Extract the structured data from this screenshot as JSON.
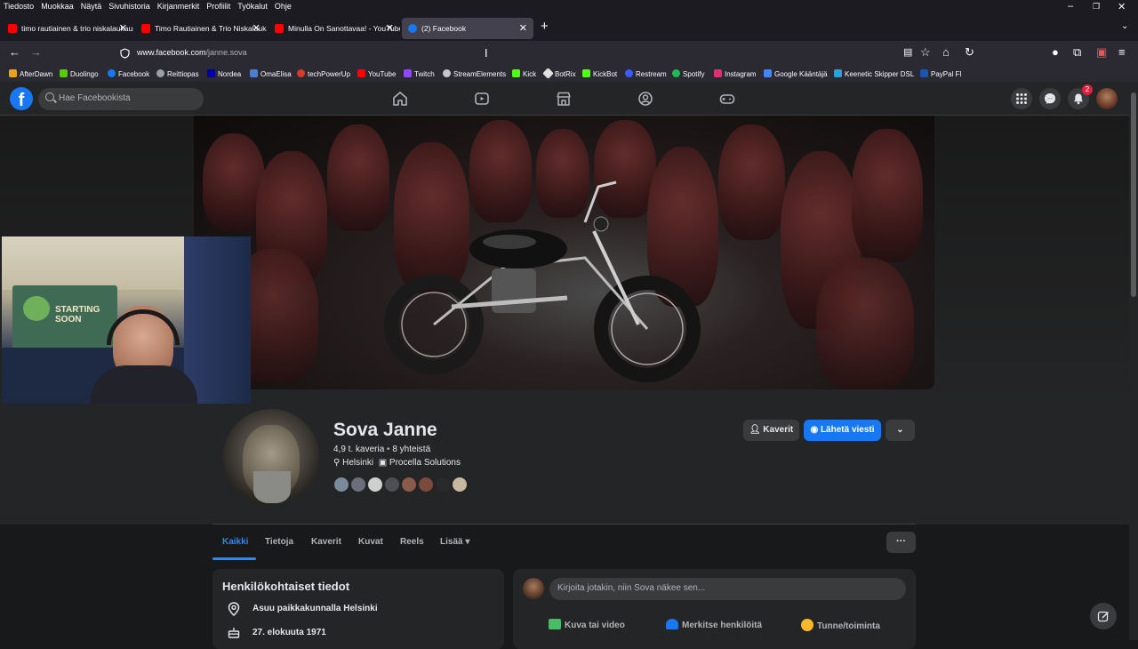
{
  "browser": {
    "menu": [
      "Tiedosto",
      "Muokkaa",
      "Näytä",
      "Sivuhistoria",
      "Kirjanmerkit",
      "Profiilit",
      "Työkalut",
      "Ohje"
    ],
    "tabs": [
      {
        "title": "timo rautiainen & trio niskalaukaus",
        "icon": "youtube-icon",
        "color": "#ff0000"
      },
      {
        "title": "Timo Rautiainen & Trio Niskalaukaus",
        "icon": "youtube-icon",
        "color": "#ff0000"
      },
      {
        "title": "Minulla On Sanottavaa! - YouTube",
        "icon": "youtube-icon",
        "color": "#ff0000"
      },
      {
        "title": "(2) Facebook",
        "icon": "facebook-icon",
        "color": "#1877f2"
      }
    ],
    "url_host": "www.facebook.com",
    "url_path": "/janne.sova",
    "bookmarks": [
      {
        "label": "AfterDawn",
        "color": "#e8a320"
      },
      {
        "label": "Duolingo",
        "color": "#58cc02"
      },
      {
        "label": "Facebook",
        "color": "#1877f2"
      },
      {
        "label": "Reittiopas",
        "color": "#9aa0a6"
      },
      {
        "label": "Nordea",
        "color": "#0000a0"
      },
      {
        "label": "OmaElisa",
        "color": "#4c7dd0"
      },
      {
        "label": "techPowerUp",
        "color": "#d83b2a"
      },
      {
        "label": "YouTube",
        "color": "#ff0000"
      },
      {
        "label": "Twitch",
        "color": "#9146ff"
      },
      {
        "label": "StreamElements",
        "color": "#c8c8c8"
      },
      {
        "label": "Kick",
        "color": "#53fc18"
      },
      {
        "label": "BotRix",
        "color": "#e0e0e0"
      },
      {
        "label": "KickBot",
        "color": "#53fc18"
      },
      {
        "label": "Restream",
        "color": "#3d5afe"
      },
      {
        "label": "Spotify",
        "color": "#1db954"
      },
      {
        "label": "Instagram",
        "color": "#e1306c"
      },
      {
        "label": "Google Kääntäjä",
        "color": "#4285f4"
      },
      {
        "label": "Keenetic Skipper DSL",
        "color": "#2aa3d4"
      },
      {
        "label": "PayPal FI",
        "color": "#1a56b0"
      }
    ]
  },
  "facebook": {
    "search_placeholder": "Hae Facebookista",
    "notification_count": "2"
  },
  "profile": {
    "name": "Sova Janne",
    "friends_count": "4,9 t. kaveria",
    "mutual_count": "8 yhteistä",
    "location": "Helsinki",
    "workplace": "Procella Solutions",
    "friends_button": "Kaverit",
    "message_button": "Lähetä viesti",
    "mutual_avatar_colors": [
      "#7a8a9a",
      "#6b6f7a",
      "#cfcfcf",
      "#4e4e55",
      "#8a5a4a",
      "#7a4a3a",
      "#2a2a2a",
      "#c8b8a0"
    ]
  },
  "tabs": [
    "Kaikki",
    "Tietoja",
    "Kaverit",
    "Kuvat",
    "Reels",
    "Lisää"
  ],
  "intro": {
    "title": "Henkilökohtaiset tiedot",
    "lives_in": "Asuu paikkakunnalla Helsinki",
    "birthday": "27. elokuuta 1971"
  },
  "composer": {
    "placeholder": "Kirjoita jotakin, niin Sova näkee sen...",
    "actions": [
      {
        "label": "Kuva tai video",
        "color": "#45bd62"
      },
      {
        "label": "Merkitse henkilöitä",
        "color": "#1877f2"
      },
      {
        "label": "Tunne/toiminta",
        "color": "#f7b928"
      }
    ]
  }
}
